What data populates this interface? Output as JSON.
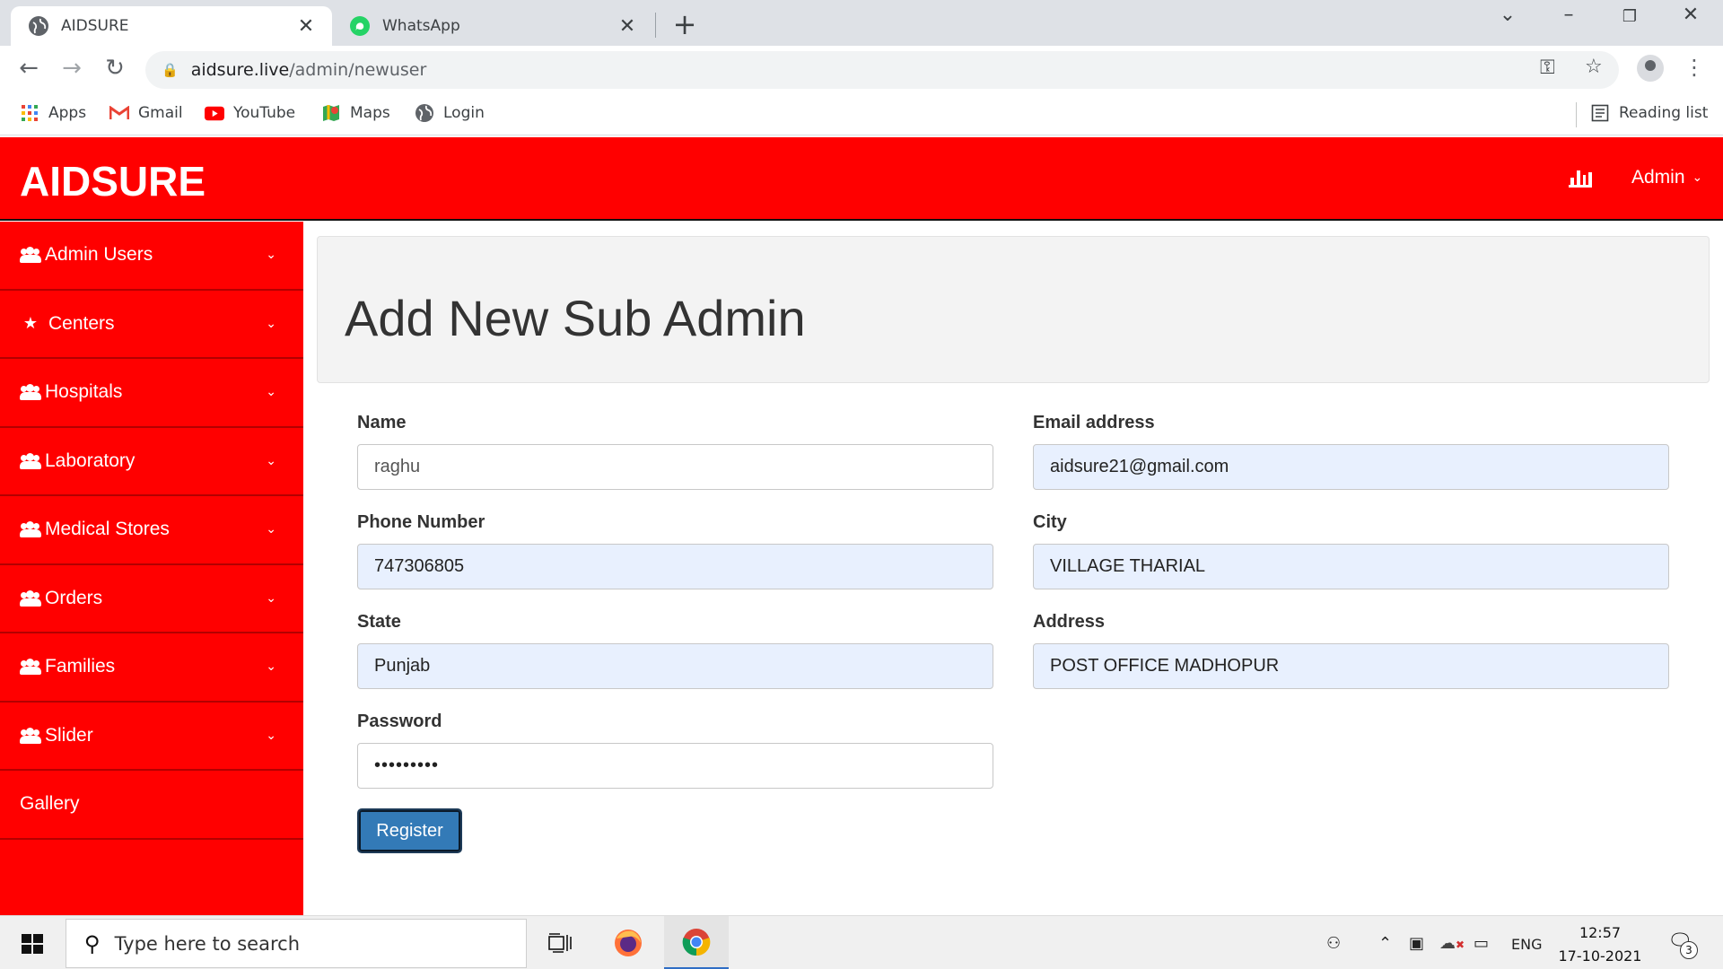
{
  "browser": {
    "tabs": [
      {
        "label": "AIDSURE",
        "active": true,
        "icon": "globe-icon"
      },
      {
        "label": "WhatsApp",
        "active": false,
        "icon": "whatsapp-icon"
      }
    ],
    "url_host": "aidsure.live",
    "url_path": "/admin/newuser",
    "bookmarks": [
      {
        "label": "Apps",
        "icon": "apps-grid-icon"
      },
      {
        "label": "Gmail",
        "icon": "gmail-icon"
      },
      {
        "label": "YouTube",
        "icon": "youtube-icon"
      },
      {
        "label": "Maps",
        "icon": "maps-icon"
      },
      {
        "label": "Login",
        "icon": "globe-icon"
      }
    ],
    "reading_list": "Reading list"
  },
  "header": {
    "brand": "AIDSURE",
    "admin_label": "Admin",
    "color": "#ff0000"
  },
  "sidebar": {
    "items": [
      {
        "label": "Admin Users",
        "icon": "users-icon",
        "has_chevron": true
      },
      {
        "label": "Centers",
        "icon": "star-icon",
        "has_chevron": true
      },
      {
        "label": "Hospitals",
        "icon": "users-icon",
        "has_chevron": true
      },
      {
        "label": "Laboratory",
        "icon": "users-icon",
        "has_chevron": true
      },
      {
        "label": "Medical Stores",
        "icon": "users-icon",
        "has_chevron": true
      },
      {
        "label": "Orders",
        "icon": "users-icon",
        "has_chevron": true
      },
      {
        "label": "Families",
        "icon": "users-icon",
        "has_chevron": true
      },
      {
        "label": "Slider",
        "icon": "users-icon",
        "has_chevron": true
      },
      {
        "label": "Gallery",
        "icon": "",
        "has_chevron": false
      }
    ]
  },
  "page": {
    "title": "Add New Sub Admin"
  },
  "form": {
    "name": {
      "label": "Name",
      "value": "raghu"
    },
    "email": {
      "label": "Email address",
      "value": "aidsure21@gmail.com"
    },
    "phone": {
      "label": "Phone Number",
      "value": "747306805"
    },
    "city": {
      "label": "City",
      "value": "VILLAGE THARIAL"
    },
    "state": {
      "label": "State",
      "value": "Punjab"
    },
    "address": {
      "label": "Address",
      "value": "POST OFFICE MADHOPUR"
    },
    "password": {
      "label": "Password",
      "value": "•••••••••"
    },
    "submit_label": "Register"
  },
  "taskbar": {
    "search_placeholder": "Type here to search",
    "language": "ENG",
    "time": "12:57",
    "date": "17-10-2021",
    "notification_count": "3"
  }
}
